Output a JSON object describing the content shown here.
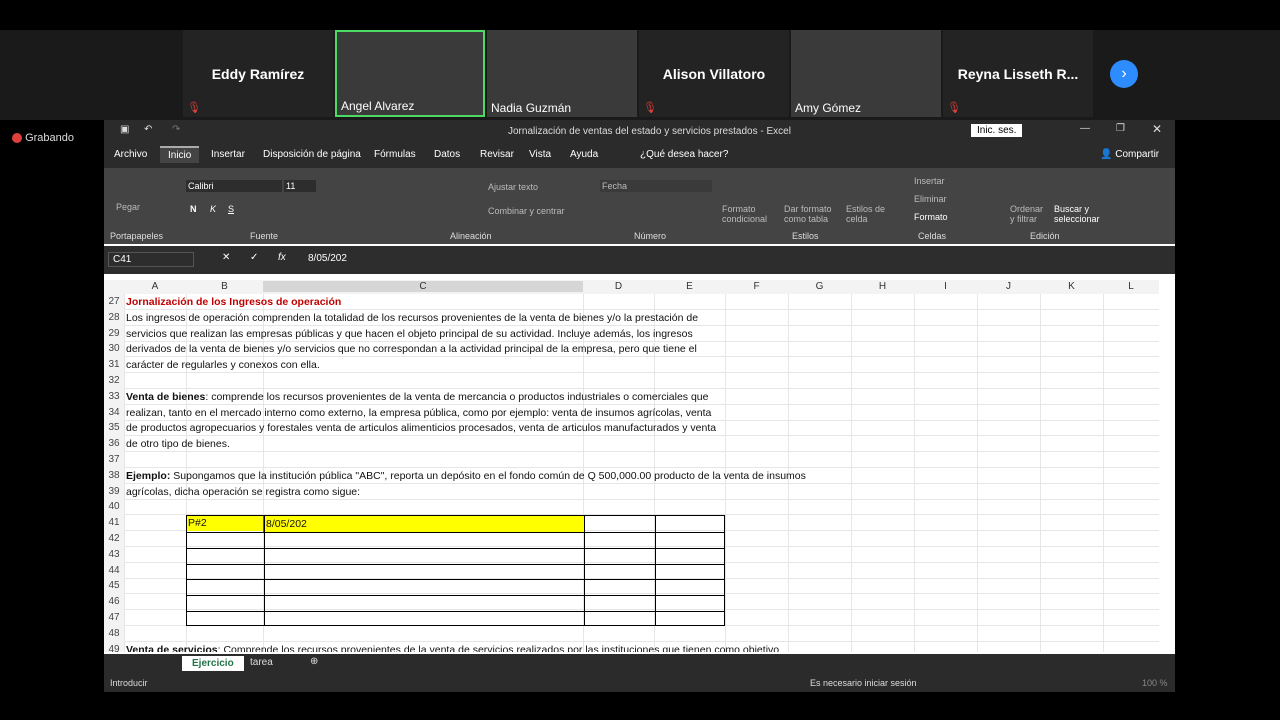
{
  "recording": "Grabando",
  "participants": [
    {
      "name": "Eddy Ramírez",
      "type": "name"
    },
    {
      "name": "Angel Alvarez",
      "type": "video"
    },
    {
      "name": "Nadia Guzmán",
      "type": "video"
    },
    {
      "name": "Alison Villatoro",
      "type": "name"
    },
    {
      "name": "Amy Gómez",
      "type": "video"
    },
    {
      "name": "Reyna Lisseth R...",
      "type": "name"
    }
  ],
  "excel": {
    "title": "Jornalización de ventas del estado y servicios prestados  -  Excel",
    "signin": "Inic. ses.",
    "tabs": [
      "Archivo",
      "Inicio",
      "Insertar",
      "Disposición de página",
      "Fórmulas",
      "Datos",
      "Revisar",
      "Vista",
      "Ayuda",
      "¿Qué desea hacer?"
    ],
    "share": "Compartir",
    "ribbon": {
      "font": "Calibri",
      "size": "11",
      "groups": [
        "Portapapeles",
        "Fuente",
        "Alineación",
        "Número",
        "Estilos",
        "Celdas",
        "Edición"
      ],
      "paste": "Pegar",
      "wrap": "Ajustar texto",
      "merge": "Combinar y centrar",
      "number_format": "Fecha",
      "cond": "Formato condicional",
      "astable": "Dar formato como tabla",
      "cellstyles": "Estilos de celda",
      "insert": "Insertar",
      "delete": "Eliminar",
      "format": "Formato",
      "sort": "Ordenar y filtrar",
      "find": "Buscar y seleccionar"
    },
    "namebox": "C41",
    "formula": "8/05/202",
    "columns": [
      "A",
      "B",
      "C",
      "D",
      "E",
      "F",
      "G",
      "H",
      "I",
      "J",
      "K",
      "L"
    ],
    "rows": [
      {
        "n": "27",
        "text": "Jornalización de los Ingresos de operación",
        "style": "title"
      },
      {
        "n": "28",
        "text": "Los ingresos de operación comprenden la totalidad de los recursos provenientes de la venta de bienes y/o la prestación de"
      },
      {
        "n": "29",
        "text": "servicios que realizan las empresas públicas y que hacen el objeto principal de su actividad. Incluye además, los ingresos"
      },
      {
        "n": "30",
        "text": "derivados de la venta de bienes y/o servicios que no correspondan a la actividad principal de la empresa, pero que tiene el"
      },
      {
        "n": "31",
        "text": "carácter de regularles y conexos con ella."
      },
      {
        "n": "32",
        "text": ""
      },
      {
        "n": "33",
        "bold": "Venta de bienes",
        "text": ": comprende los recursos provenientes de la venta de mercancia o productos industriales o comerciales que"
      },
      {
        "n": "34",
        "text": "realizan, tanto en el mercado interno como externo, la empresa pública, como por ejemplo: venta de insumos agrícolas, venta"
      },
      {
        "n": "35",
        "text": "de productos agropecuarios y forestales venta de articulos alimenticios procesados, venta de articulos manufacturados y venta"
      },
      {
        "n": "36",
        "text": "de otro tipo de bienes."
      },
      {
        "n": "37",
        "text": ""
      },
      {
        "n": "38",
        "bold": "Ejemplo:",
        "text": " Supongamos que la institución pública \"ABC\", reporta un depósito en el fondo común de Q 500,000.00 producto de la venta de insumos"
      },
      {
        "n": "39",
        "text": "agrícolas, dicha operación se registra como sigue:"
      },
      {
        "n": "40",
        "text": ""
      },
      {
        "n": "41",
        "b": "P#2",
        "c": "8/05/202"
      },
      {
        "n": "42",
        "text": ""
      },
      {
        "n": "43",
        "text": ""
      },
      {
        "n": "44",
        "text": ""
      },
      {
        "n": "45",
        "text": ""
      },
      {
        "n": "46",
        "text": ""
      },
      {
        "n": "47",
        "text": ""
      },
      {
        "n": "48",
        "text": ""
      },
      {
        "n": "49",
        "bold": "Venta de servicios",
        "text": ": Comprende los recursos provenientes de la venta de servicios realizados por las instituciones que tienen como objetivo"
      }
    ],
    "sheets": [
      "Ejercicio",
      "tarea"
    ],
    "status": "Introducir",
    "status_right": "Es necesario iniciar sesión",
    "zoom": "100 %"
  }
}
